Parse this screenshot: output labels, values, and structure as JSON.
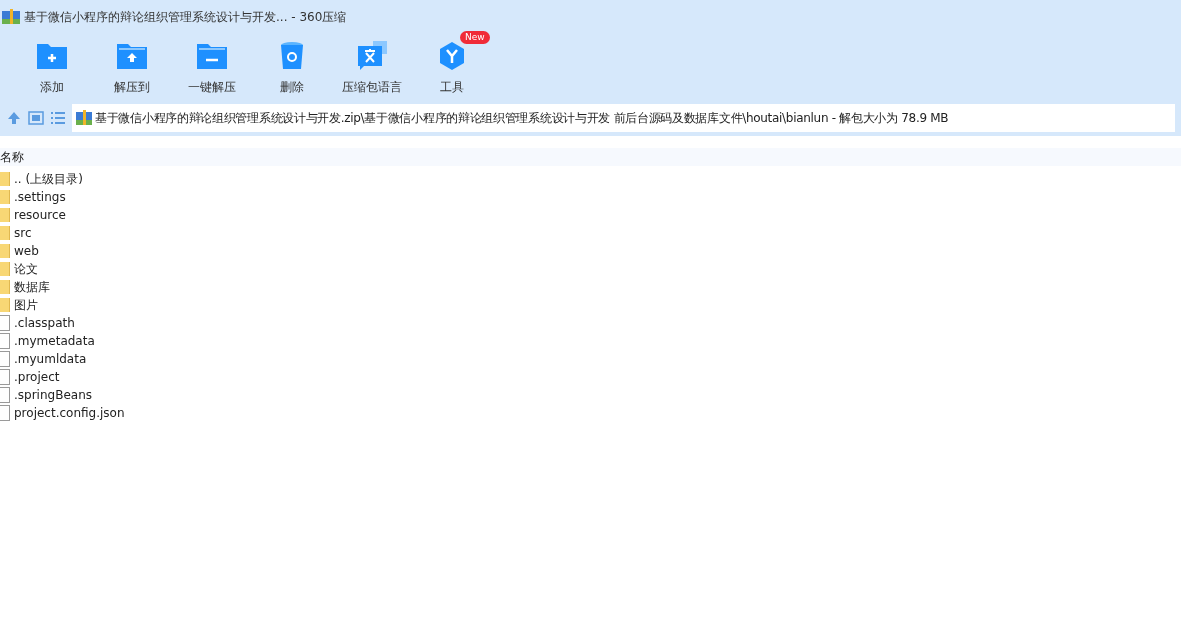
{
  "window": {
    "title": "基于微信小程序的辩论组织管理系统设计与开发... - 360压缩"
  },
  "toolbar": [
    {
      "label": "添加",
      "kind": "add"
    },
    {
      "label": "解压到",
      "kind": "extract"
    },
    {
      "label": "一键解压",
      "kind": "oneclick"
    },
    {
      "label": "删除",
      "kind": "delete"
    },
    {
      "label": "压缩包语言",
      "kind": "language"
    },
    {
      "label": "工具",
      "kind": "tools",
      "badge": "New"
    }
  ],
  "address_bar": {
    "path": "基于微信小程序的辩论组织管理系统设计与开发.zip\\基于微信小程序的辩论组织管理系统设计与开发 前后台源码及数据库文件\\houtai\\bianlun - 解包大小为 78.9 MB"
  },
  "table": {
    "columns": [
      "名称"
    ],
    "rows": [
      {
        "name": ".. (上级目录)",
        "kind": "folder"
      },
      {
        "name": ".settings",
        "kind": "folder"
      },
      {
        "name": "resource",
        "kind": "folder"
      },
      {
        "name": "src",
        "kind": "folder"
      },
      {
        "name": "web",
        "kind": "folder"
      },
      {
        "name": "论文",
        "kind": "folder"
      },
      {
        "name": "数据库",
        "kind": "folder"
      },
      {
        "name": "图片",
        "kind": "folder"
      },
      {
        "name": ".classpath",
        "kind": "file"
      },
      {
        "name": ".mymetadata",
        "kind": "file"
      },
      {
        "name": ".myumldata",
        "kind": "file"
      },
      {
        "name": ".project",
        "kind": "file"
      },
      {
        "name": ".springBeans",
        "kind": "file"
      },
      {
        "name": "project.config.json",
        "kind": "file"
      }
    ]
  }
}
